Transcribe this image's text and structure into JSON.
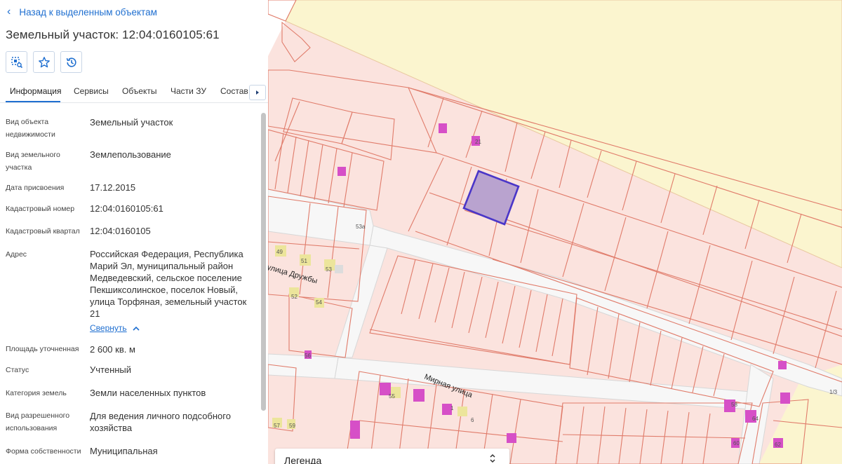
{
  "back_link": {
    "label": "Назад к выделенным объектам"
  },
  "title": "Земельный участок: 12:04:0160105:61",
  "toolbar": {
    "select_icon": "area-search-icon",
    "favorite_icon": "star-icon",
    "history_icon": "history-icon"
  },
  "tabs": [
    {
      "label": "Информация",
      "active": true
    },
    {
      "label": "Сервисы"
    },
    {
      "label": "Объекты"
    },
    {
      "label": "Части ЗУ"
    },
    {
      "label": "Состав"
    }
  ],
  "attributes": [
    {
      "label": "Вид объекта недвижимости",
      "value": "Земельный участок"
    },
    {
      "label": "Вид земельного участка",
      "value": "Землепользование"
    },
    {
      "label": "Дата присвоения",
      "value": "17.12.2015"
    },
    {
      "label": "Кадастровый номер",
      "value": "12:04:0160105:61"
    },
    {
      "label": "Кадастровый квартал",
      "value": "12:04:0160105"
    },
    {
      "label": "Адрес",
      "value": "Российская Федерация, Республика Марий Эл, муниципальный район Медведевский, сельское поселение Пекшиксолинское, поселок Новый, улица Торфяная, земельный участок 21"
    },
    {
      "label": "Площадь уточненная",
      "value": "2 600 кв. м"
    },
    {
      "label": "Статус",
      "value": "Учтенный"
    },
    {
      "label": "Категория земель",
      "value": "Земли населенных пунктов"
    },
    {
      "label": "Вид разрешенного использования",
      "value": "Для ведения личного подсобного хозяйства"
    },
    {
      "label": "Форма собственности",
      "value": "Муниципальная"
    }
  ],
  "collapse_label": "Свернуть",
  "map": {
    "streets": [
      "улица Дружбы",
      "Мирная улица"
    ],
    "house_numbers": [
      "21",
      "53а",
      "49",
      "51",
      "53",
      "52",
      "54",
      "56",
      "55",
      "57",
      "59",
      "1",
      "6",
      "58",
      "64",
      "60",
      "62",
      "1/3"
    ],
    "colors": {
      "parcel_fill": "#fbe3de",
      "parcel_stroke": "#e07b6a",
      "selected_fill": "#b9a3cf",
      "selected_stroke": "#4a36c8",
      "building": "#d64fc7",
      "forest": "#fbf5cf",
      "road": "#f7f7f7"
    }
  },
  "legend": {
    "title": "Легенда"
  }
}
